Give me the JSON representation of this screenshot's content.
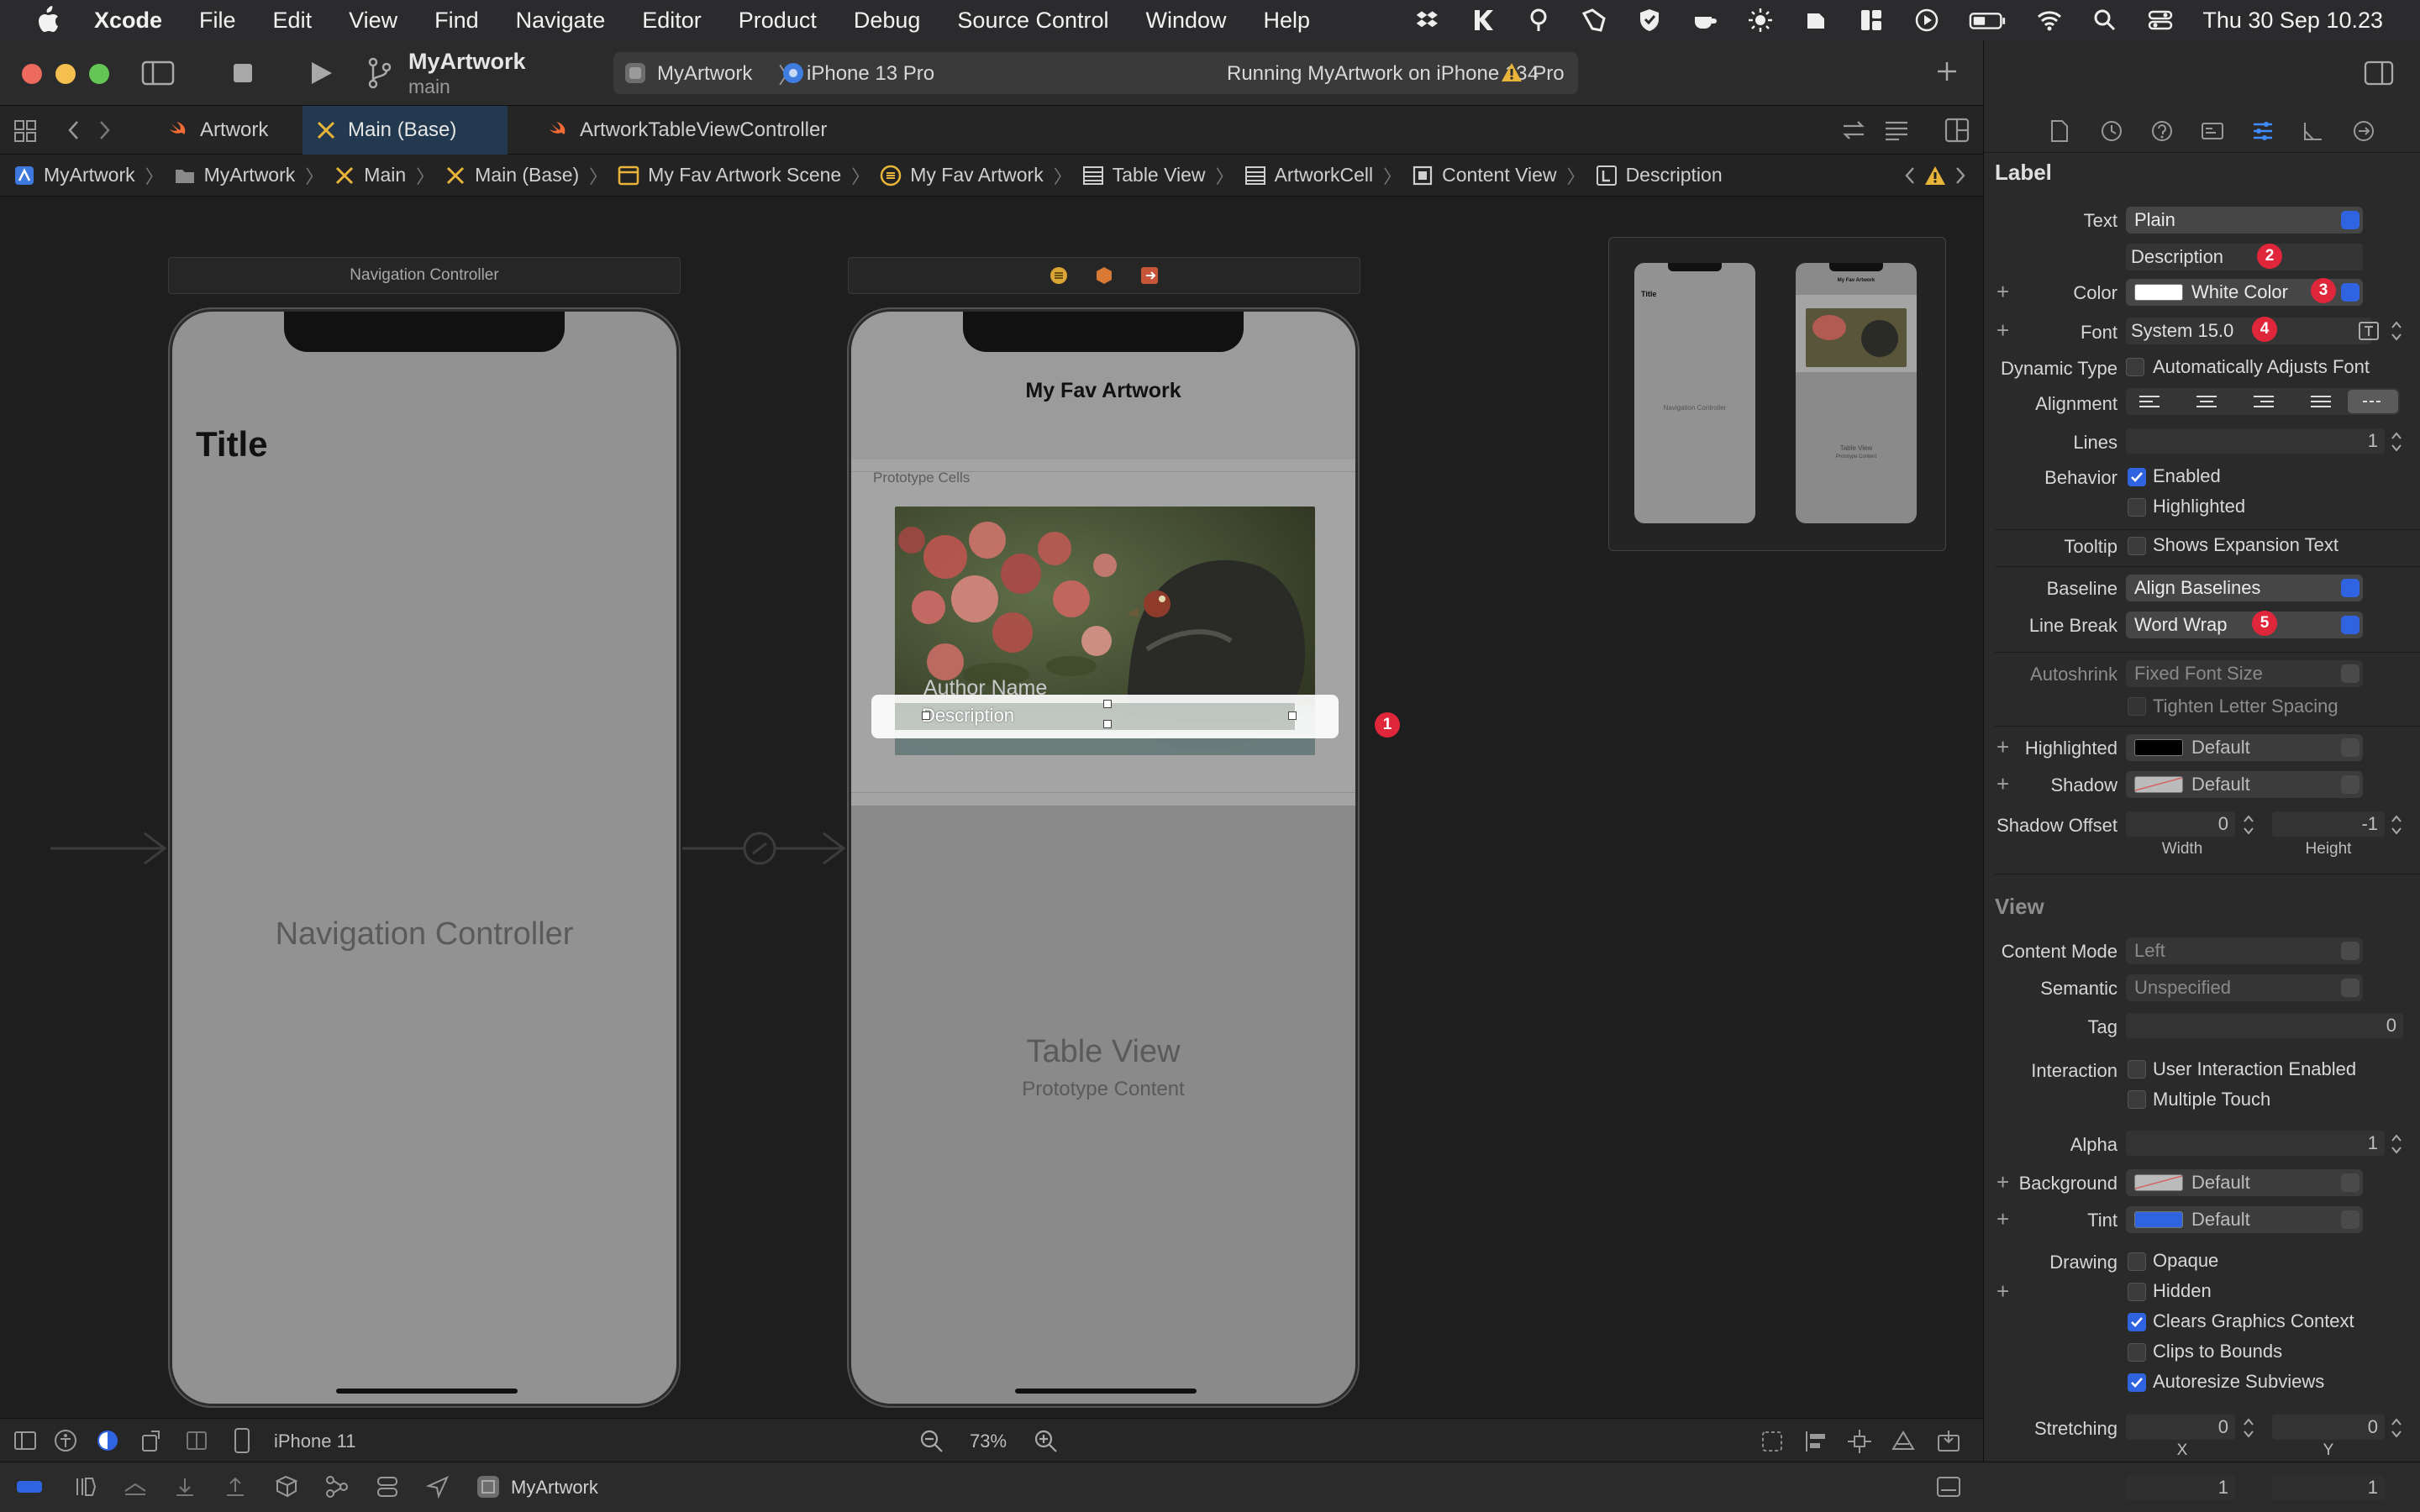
{
  "menubar": {
    "items": [
      "Xcode",
      "File",
      "Edit",
      "View",
      "Find",
      "Navigate",
      "Editor",
      "Product",
      "Debug",
      "Source Control",
      "Window",
      "Help"
    ],
    "clock": "Thu 30 Sep  10.23"
  },
  "toolbar": {
    "project": "MyArtwork",
    "branch": "main",
    "scheme_target": "MyArtwork",
    "scheme_device": "iPhone 13 Pro",
    "run_status": "Running MyArtwork on iPhone 13 Pro",
    "warning_count": "4"
  },
  "tabs": [
    {
      "label": "Artwork",
      "active": false
    },
    {
      "label": "Main (Base)",
      "active": true
    },
    {
      "label": "ArtworkTableViewController",
      "active": false
    }
  ],
  "breadcrumbs": [
    "MyArtwork",
    "MyArtwork",
    "Main",
    "Main (Base)",
    "My Fav Artwork Scene",
    "My Fav Artwork",
    "Table View",
    "ArtworkCell",
    "Content View",
    "Description"
  ],
  "canvas": {
    "nav_scene_title": "Navigation Controller",
    "nav_large_title": "Title",
    "nav_center_label": "Navigation Controller",
    "table_nav_title": "My Fav Artwork",
    "prototype_cells_label": "Prototype Cells",
    "author_label": "Author Name",
    "description_label": "Description",
    "table_view_label": "Table View",
    "prototype_content_label": "Prototype Content",
    "badge_1": "1"
  },
  "minimap": {
    "mini_title": "Title",
    "mini_nav": "Navigation Controller",
    "mini_table_title": "My Fav Artwork",
    "mini_table_view": "Table View",
    "mini_prototype": "Prototype Content"
  },
  "debugbar": {
    "device": "iPhone 11",
    "zoom": "73%",
    "scheme": "MyArtwork"
  },
  "inspector": {
    "label_section": "Label",
    "text_label": "Text",
    "text_type": "Plain",
    "text_value": "Description",
    "color_label": "Color",
    "color_value": "White Color",
    "font_label": "Font",
    "font_value": "System 15.0",
    "dynamic_type_label": "Dynamic Type",
    "dynamic_type_option": "Automatically Adjusts Font",
    "alignment_label": "Alignment",
    "lines_label": "Lines",
    "lines_value": "1",
    "behavior_label": "Behavior",
    "enabled_option": "Enabled",
    "highlighted_option": "Highlighted",
    "tooltip_label": "Tooltip",
    "tooltip_option": "Shows Expansion Text",
    "baseline_label": "Baseline",
    "baseline_value": "Align Baselines",
    "line_break_label": "Line Break",
    "line_break_value": "Word Wrap",
    "autoshrink_label": "Autoshrink",
    "autoshrink_value": "Fixed Font Size",
    "tighten_option": "Tighten Letter Spacing",
    "highlighted_label": "Highlighted",
    "highlighted_value": "Default",
    "shadow_label": "Shadow",
    "shadow_value": "Default",
    "shadow_offset_label": "Shadow Offset",
    "shadow_offset_w": "0",
    "shadow_offset_h": "-1",
    "width_label": "Width",
    "height_label": "Height",
    "view_section": "View",
    "content_mode_label": "Content Mode",
    "content_mode_value": "Left",
    "semantic_label": "Semantic",
    "semantic_value": "Unspecified",
    "tag_label": "Tag",
    "tag_value": "0",
    "interaction_label": "Interaction",
    "user_interaction_option": "User Interaction Enabled",
    "multiple_touch_option": "Multiple Touch",
    "alpha_label": "Alpha",
    "alpha_value": "1",
    "background_label": "Background",
    "background_value": "Default",
    "tint_label": "Tint",
    "tint_value": "Default",
    "drawing_label": "Drawing",
    "opaque_option": "Opaque",
    "hidden_option": "Hidden",
    "clears_option": "Clears Graphics Context",
    "clips_option": "Clips to Bounds",
    "autoresize_option": "Autoresize Subviews",
    "stretching_label": "Stretching",
    "stretch_x_value": "0",
    "stretch_y_value": "0",
    "x_label": "X",
    "y_label": "Y",
    "stretch_w_value": "1",
    "stretch_h_value": "1",
    "badges": [
      "2",
      "3",
      "4",
      "5"
    ]
  },
  "colors": {
    "accent": "#2f63e0",
    "badge": "#e0263a",
    "warning": "#e8b53a"
  }
}
